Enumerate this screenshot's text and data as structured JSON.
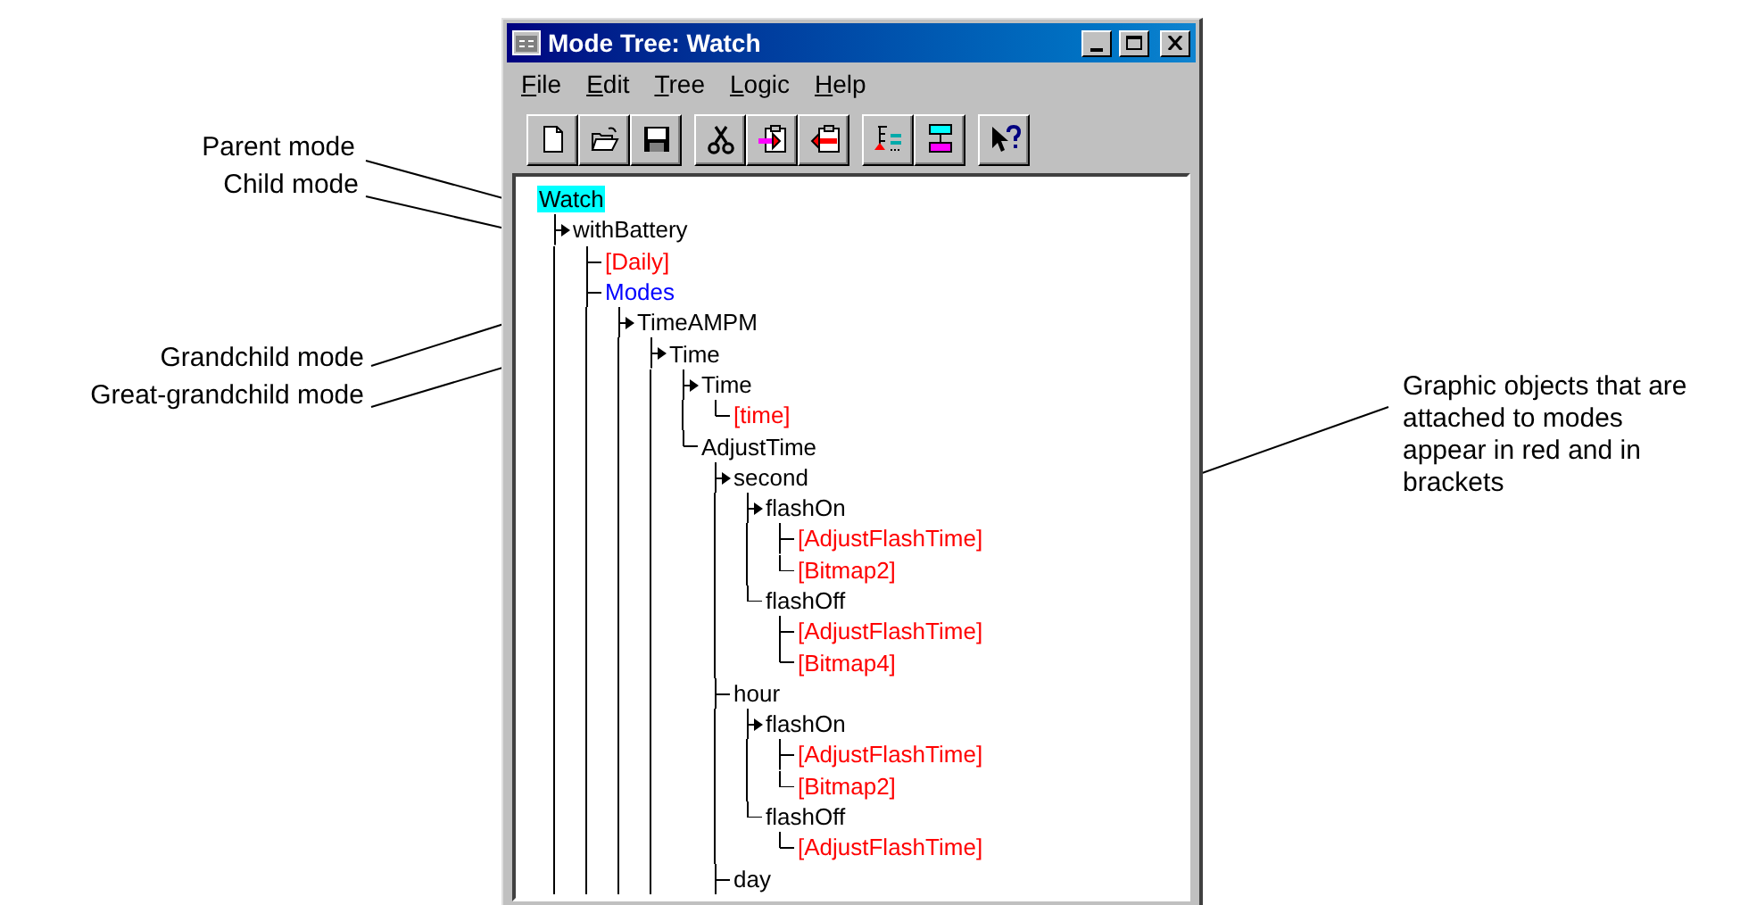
{
  "window": {
    "title": "Mode Tree: Watch"
  },
  "menu": [
    {
      "label": "File"
    },
    {
      "label": "Edit"
    },
    {
      "label": "Tree"
    },
    {
      "label": "Logic"
    },
    {
      "label": "Help"
    }
  ],
  "toolbar_groups": [
    {
      "buttons": [
        {
          "kind": "new"
        },
        {
          "kind": "open"
        },
        {
          "kind": "save"
        }
      ]
    },
    {
      "buttons": [
        {
          "kind": "cut"
        },
        {
          "kind": "paste_in"
        },
        {
          "kind": "paste_out"
        }
      ]
    },
    {
      "buttons": [
        {
          "kind": "tree"
        },
        {
          "kind": "chart"
        }
      ]
    },
    {
      "buttons": [
        {
          "kind": "help"
        }
      ]
    }
  ],
  "tree": [
    {
      "label": "Watch",
      "kind": "mode",
      "selected": true,
      "children": [
        {
          "label": "withBattery",
          "kind": "mode",
          "initial": true,
          "selected": false,
          "siblings_below": true,
          "children": [
            {
              "label": "[Daily]",
              "kind": "object",
              "initial": false,
              "selected": false,
              "siblings_below": true
            },
            {
              "label": "Modes",
              "kind": "group",
              "initial": false,
              "selected": false,
              "siblings_below": true,
              "children": [
                {
                  "label": "TimeAMPM",
                  "kind": "mode",
                  "initial": true,
                  "selected": false,
                  "siblings_below": true,
                  "children": [
                    {
                      "label": "Time",
                      "kind": "mode",
                      "initial": true,
                      "selected": false,
                      "siblings_below": true,
                      "children": [
                        {
                          "label": "Time",
                          "kind": "mode",
                          "initial": true,
                          "selected": false,
                          "siblings_below": true,
                          "children": [
                            {
                              "label": "[time]",
                              "kind": "object",
                              "initial": false,
                              "selected": false,
                              "siblings_below": false
                            }
                          ]
                        },
                        {
                          "label": "AdjustTime",
                          "kind": "mode",
                          "initial": false,
                          "selected": false,
                          "siblings_below": false,
                          "children": [
                            {
                              "label": "second",
                              "kind": "mode",
                              "initial": true,
                              "selected": false,
                              "siblings_below": true,
                              "children": [
                                {
                                  "label": "flashOn",
                                  "kind": "mode",
                                  "initial": true,
                                  "selected": false,
                                  "siblings_below": true,
                                  "children": [
                                    {
                                      "label": "[AdjustFlashTime]",
                                      "kind": "object",
                                      "initial": false,
                                      "selected": false,
                                      "siblings_below": true
                                    },
                                    {
                                      "label": "[Bitmap2]",
                                      "kind": "object",
                                      "initial": false,
                                      "selected": false,
                                      "siblings_below": false
                                    }
                                  ]
                                },
                                {
                                  "label": "flashOff",
                                  "kind": "mode",
                                  "initial": false,
                                  "selected": false,
                                  "siblings_below": false,
                                  "children": [
                                    {
                                      "label": "[AdjustFlashTime]",
                                      "kind": "object",
                                      "initial": false,
                                      "selected": false,
                                      "siblings_below": true
                                    },
                                    {
                                      "label": "[Bitmap4]",
                                      "kind": "object",
                                      "initial": false,
                                      "selected": false,
                                      "siblings_below": false
                                    }
                                  ]
                                }
                              ]
                            },
                            {
                              "label": "hour",
                              "kind": "mode",
                              "initial": false,
                              "selected": false,
                              "siblings_below": true,
                              "children": [
                                {
                                  "label": "flashOn",
                                  "kind": "mode",
                                  "initial": true,
                                  "selected": false,
                                  "siblings_below": true,
                                  "children": [
                                    {
                                      "label": "[AdjustFlashTime]",
                                      "kind": "object",
                                      "initial": false,
                                      "selected": false,
                                      "siblings_below": true
                                    },
                                    {
                                      "label": "[Bitmap2]",
                                      "kind": "object",
                                      "initial": false,
                                      "selected": false,
                                      "siblings_below": false
                                    }
                                  ]
                                },
                                {
                                  "label": "flashOff",
                                  "kind": "mode",
                                  "initial": false,
                                  "selected": false,
                                  "siblings_below": false,
                                  "children": [
                                    {
                                      "label": "[AdjustFlashTime]",
                                      "kind": "object",
                                      "initial": false,
                                      "selected": false,
                                      "siblings_below": false
                                    }
                                  ]
                                }
                              ]
                            },
                            {
                              "label": "day",
                              "kind": "mode",
                              "initial": false,
                              "selected": false,
                              "siblings_below": true
                            }
                          ]
                        }
                      ]
                    }
                  ]
                }
              ]
            }
          ]
        }
      ]
    }
  ],
  "callouts": [
    {
      "text": "Parent mode"
    },
    {
      "text": "Child mode"
    },
    {
      "text": "Grandchild mode"
    },
    {
      "text": "Great-grandchild mode"
    },
    {
      "text": "Graphic objects that are attached to modes appear in red and in brackets"
    }
  ]
}
